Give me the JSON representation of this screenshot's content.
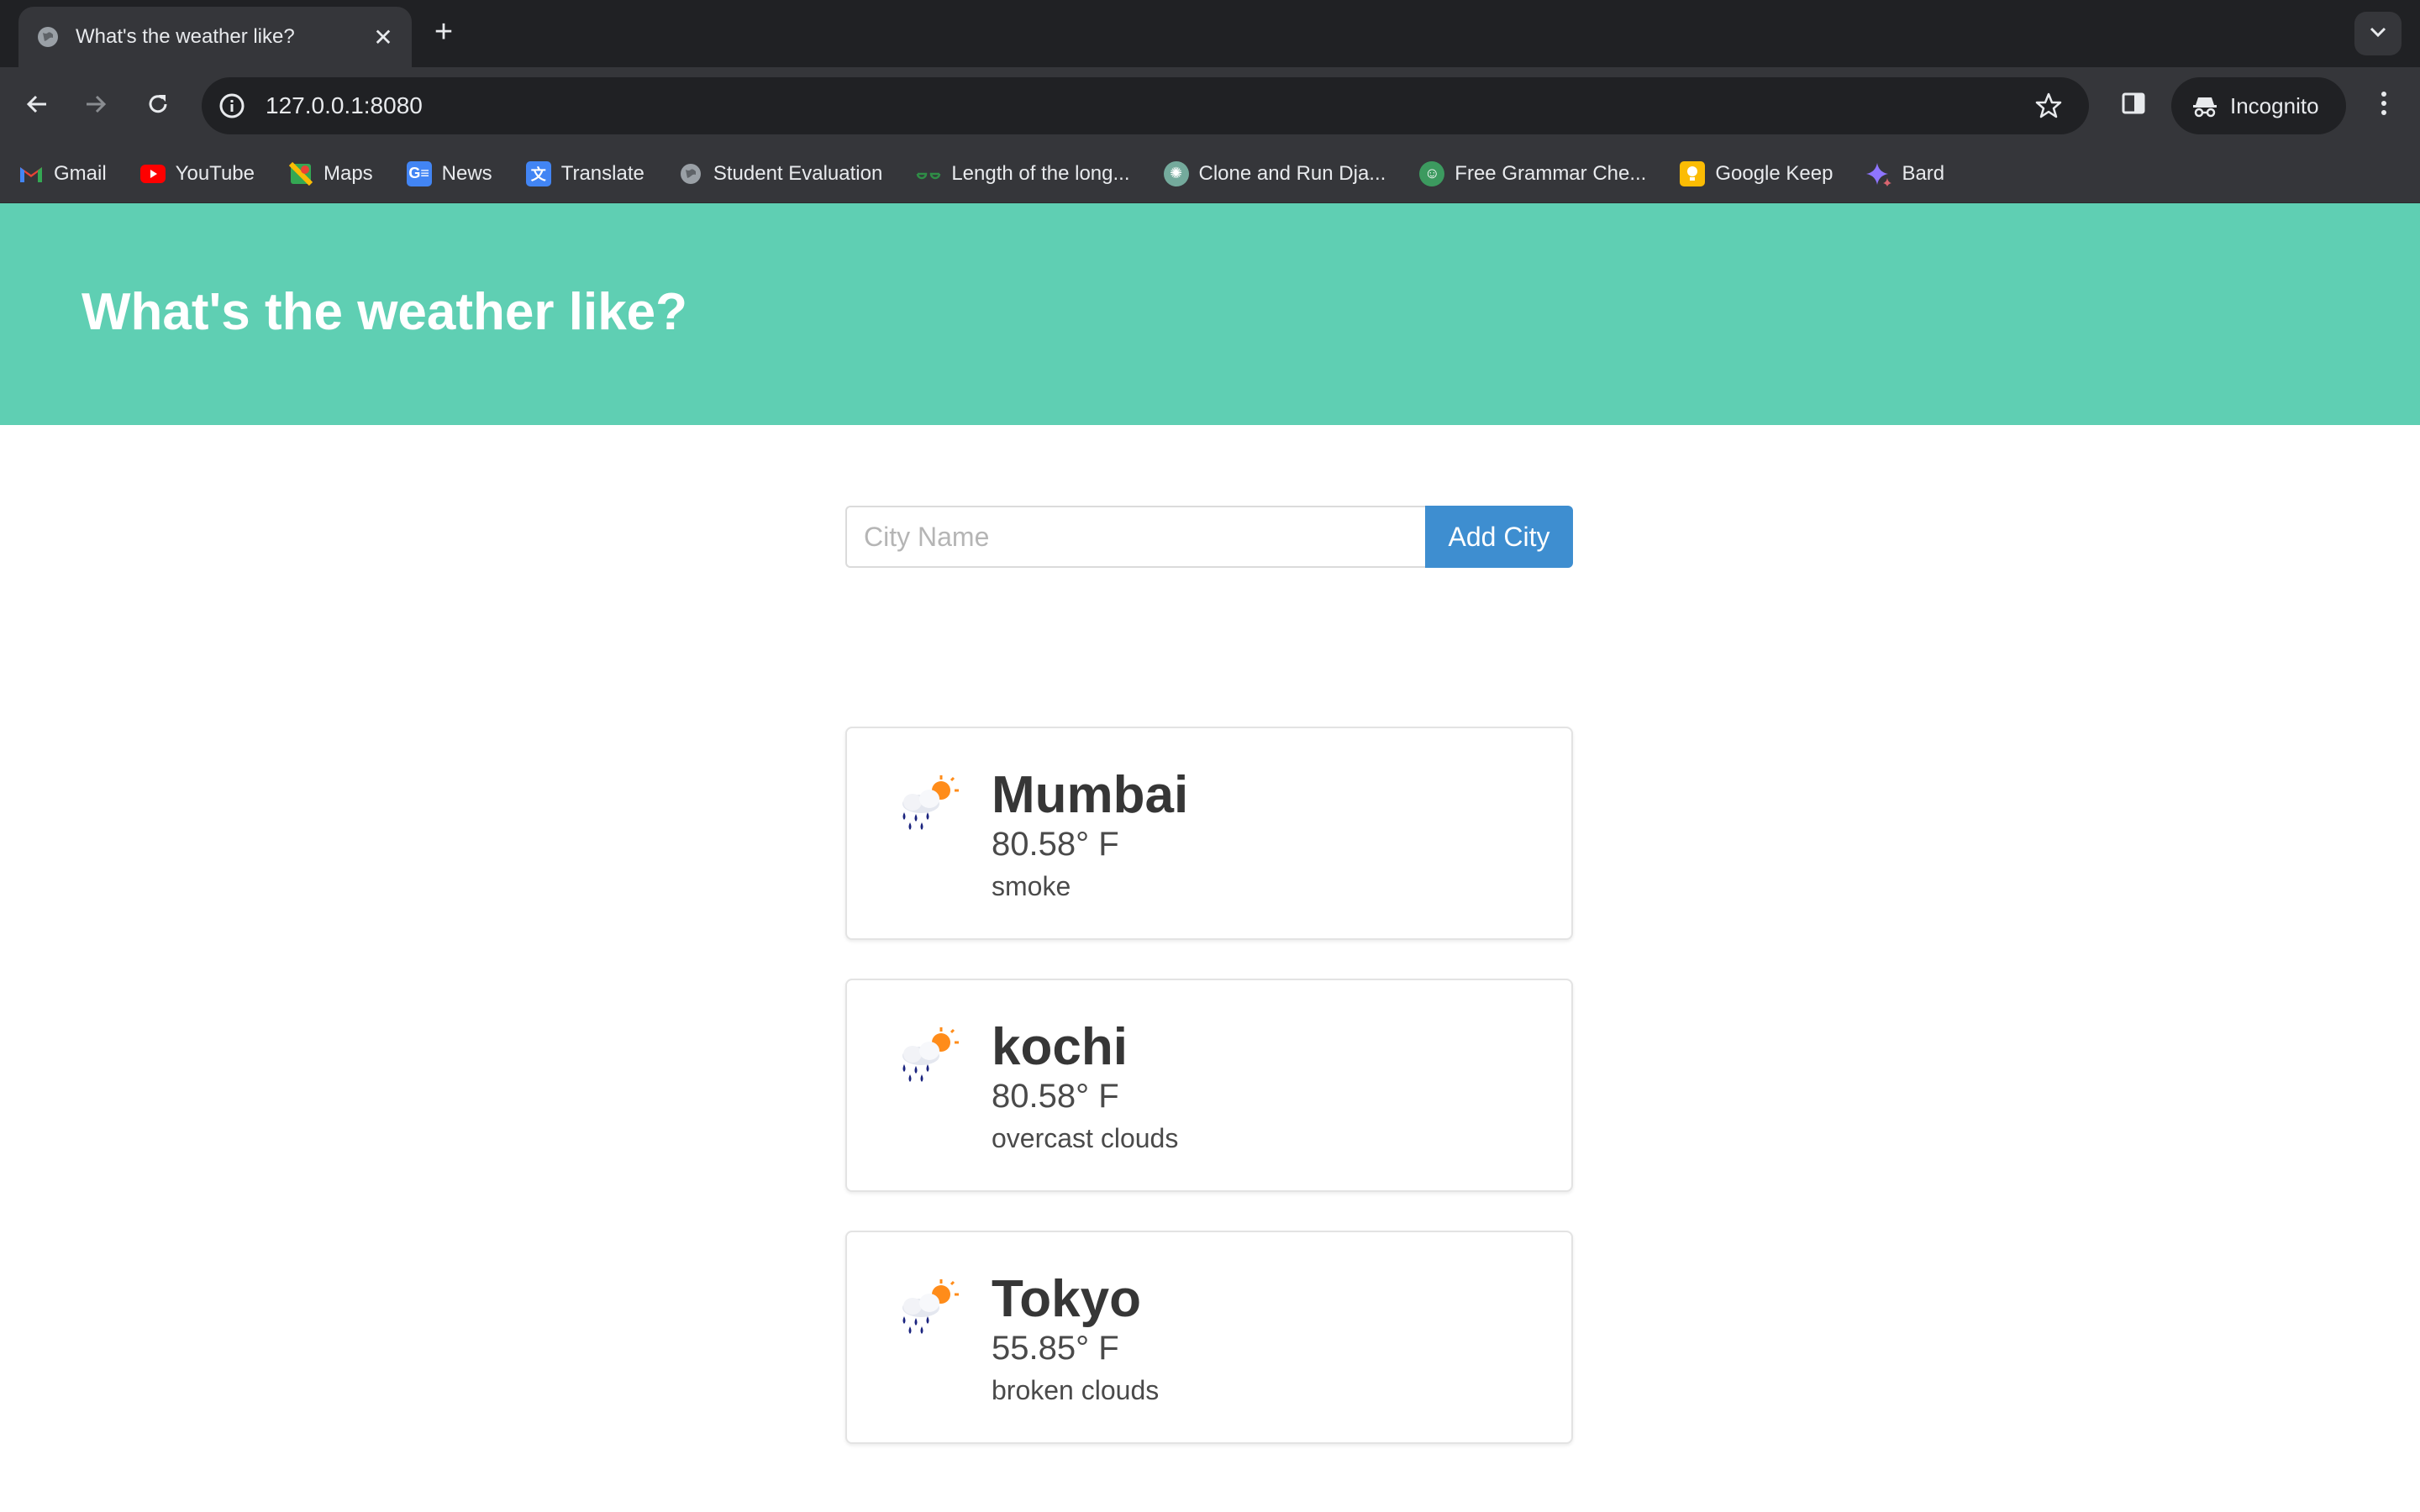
{
  "browser": {
    "tab_title": "What's the weather like?",
    "url": "127.0.0.1:8080",
    "profile_label": "Incognito",
    "bookmarks": [
      {
        "label": "Gmail",
        "icon": "gmail-icon",
        "color": "#ea4335"
      },
      {
        "label": "YouTube",
        "icon": "youtube-icon",
        "color": "#ff0000"
      },
      {
        "label": "Maps",
        "icon": "maps-icon",
        "color": "#34a853"
      },
      {
        "label": "News",
        "icon": "news-icon",
        "color": "#4285f4"
      },
      {
        "label": "Translate",
        "icon": "translate-icon",
        "color": "#4285f4"
      },
      {
        "label": "Student Evaluation",
        "icon": "globe-icon",
        "color": "#9aa0a6"
      },
      {
        "label": "Length of the long...",
        "icon": "geeks-icon",
        "color": "#2f8d46"
      },
      {
        "label": "Clone and Run Dja...",
        "icon": "chatgpt-icon",
        "color": "#74aa9c"
      },
      {
        "label": "Free Grammar Che...",
        "icon": "grammar-icon",
        "color": "#3c9a5f"
      },
      {
        "label": "Google Keep",
        "icon": "keep-icon",
        "color": "#fbbc04"
      },
      {
        "label": "Bard",
        "icon": "bard-icon",
        "color": "#8e75ff"
      }
    ]
  },
  "hero": {
    "title": "What's the weather like?",
    "background": "#5fcfb3"
  },
  "form": {
    "placeholder": "City Name",
    "value": "",
    "button_label": "Add City",
    "button_color": "#3e8ed0"
  },
  "cities": [
    {
      "name": "Mumbai",
      "temperature": "80.58° F",
      "description": "smoke",
      "icon": "rain-sun-cloud-icon"
    },
    {
      "name": "kochi",
      "temperature": "80.58° F",
      "description": "overcast clouds",
      "icon": "rain-sun-cloud-icon"
    },
    {
      "name": "Tokyo",
      "temperature": "55.85° F",
      "description": "broken clouds",
      "icon": "rain-sun-cloud-icon"
    }
  ]
}
